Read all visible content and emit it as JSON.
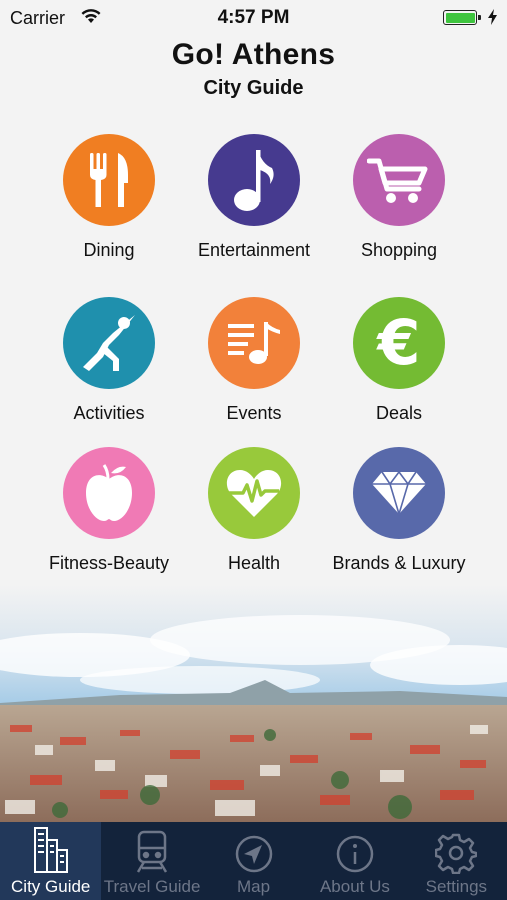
{
  "status_bar": {
    "carrier": "Carrier",
    "time": "4:57 PM",
    "battery_level": 1.0
  },
  "header": {
    "title": "Go! Athens",
    "subtitle": "City Guide"
  },
  "categories": [
    {
      "label": "Dining",
      "color": "#f07e22",
      "icon": "dining-icon"
    },
    {
      "label": "Entertainment",
      "color": "#463a8f",
      "icon": "music-note-icon"
    },
    {
      "label": "Shopping",
      "color": "#bb5fae",
      "icon": "shopping-cart-icon"
    },
    {
      "label": "Activities",
      "color": "#1f90ad",
      "icon": "activities-icon"
    },
    {
      "label": "Events",
      "color": "#f2813a",
      "icon": "events-icon"
    },
    {
      "label": "Deals",
      "color": "#74bb33",
      "icon": "euro-icon"
    },
    {
      "label": "Fitness-Beauty",
      "color": "#f07ab5",
      "icon": "apple-icon"
    },
    {
      "label": "Health",
      "color": "#98c93b",
      "icon": "heart-pulse-icon"
    },
    {
      "label": "Brands & Luxury",
      "color": "#5869aa",
      "icon": "diamond-icon"
    }
  ],
  "tab_bar": {
    "tabs": [
      {
        "label": "City Guide",
        "icon": "buildings-icon",
        "active": true
      },
      {
        "label": "Travel Guide",
        "icon": "train-icon",
        "active": false
      },
      {
        "label": "Map",
        "icon": "compass-icon",
        "active": false
      },
      {
        "label": "About Us",
        "icon": "info-icon",
        "active": false
      },
      {
        "label": "Settings",
        "icon": "gear-icon",
        "active": false
      }
    ]
  }
}
